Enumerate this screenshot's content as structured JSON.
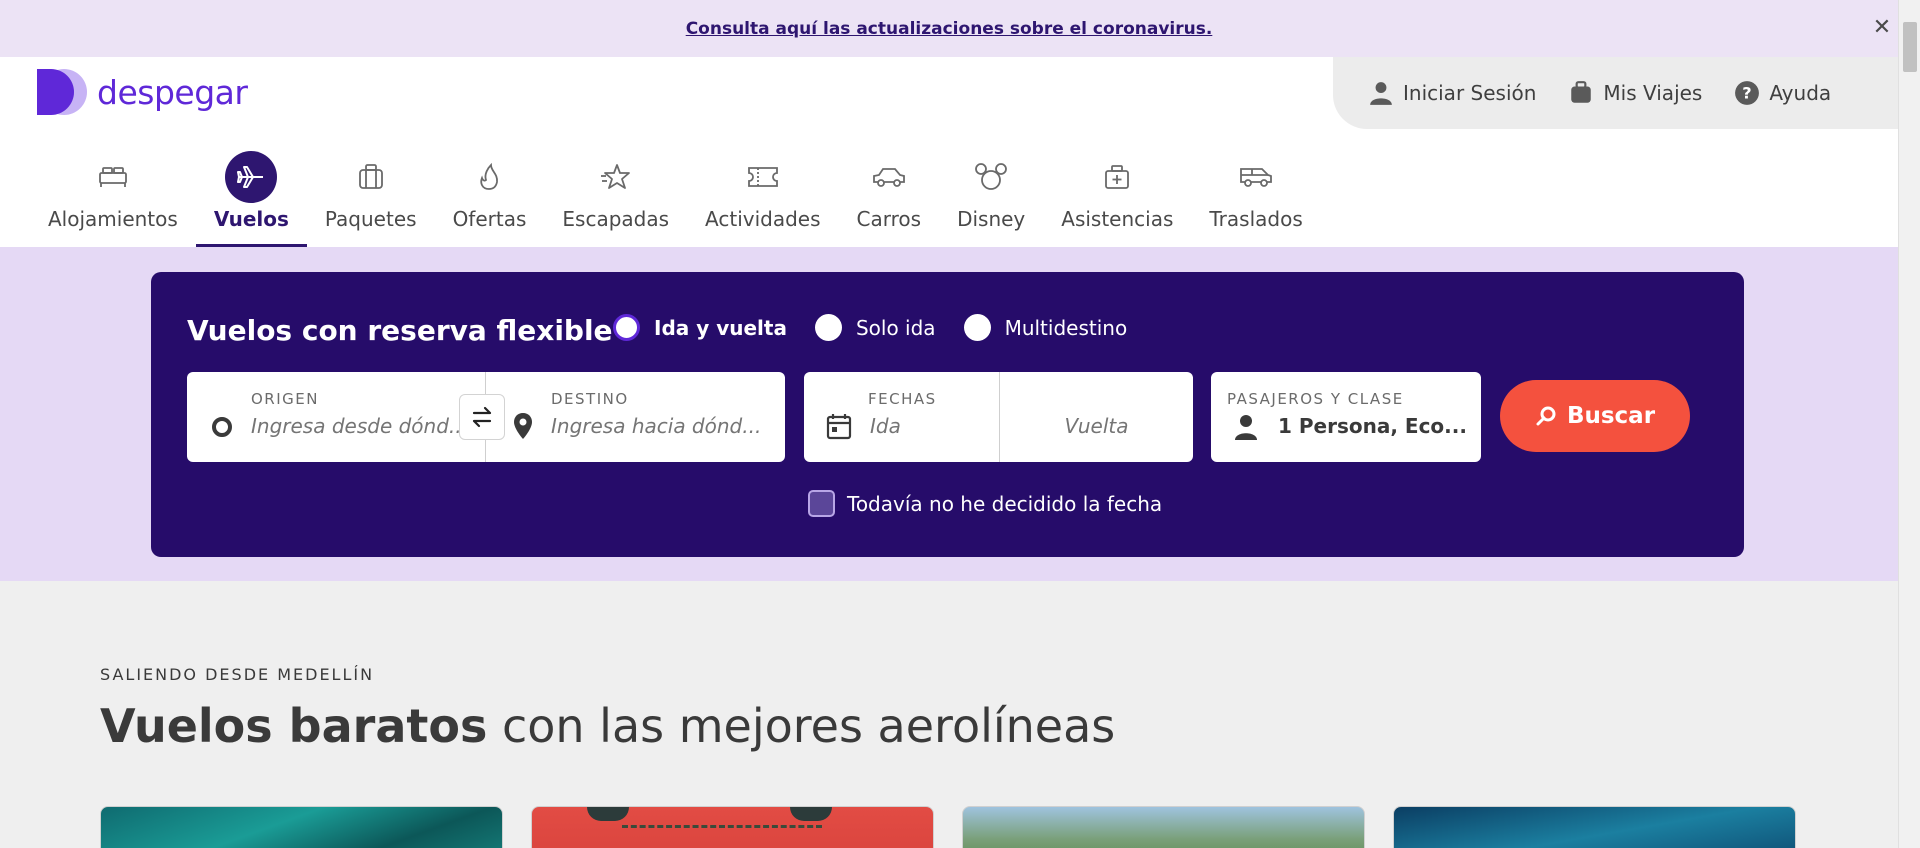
{
  "banner": {
    "link_text": "Consulta aquí las actualizaciones sobre el coronavirus.",
    "close_icon": "close-icon"
  },
  "brand": {
    "name": "despegar",
    "color": "#5f28d8",
    "primary_dark": "#260c6a",
    "accent": "#f4513e"
  },
  "user_menu": {
    "items": [
      {
        "label": "Iniciar Sesión",
        "icon": "user-icon"
      },
      {
        "label": "Mis Viajes",
        "icon": "suitcase-icon"
      },
      {
        "label": "Ayuda",
        "icon": "help-icon"
      }
    ]
  },
  "nav": {
    "items": [
      {
        "label": "Alojamientos",
        "icon": "bed-icon",
        "active": false
      },
      {
        "label": "Vuelos",
        "icon": "plane-icon",
        "active": true
      },
      {
        "label": "Paquetes",
        "icon": "luggage-icon",
        "active": false
      },
      {
        "label": "Ofertas",
        "icon": "flame-icon",
        "active": false
      },
      {
        "label": "Escapadas",
        "icon": "star-icon",
        "active": false
      },
      {
        "label": "Actividades",
        "icon": "ticket-icon",
        "active": false
      },
      {
        "label": "Carros",
        "icon": "car-icon",
        "active": false
      },
      {
        "label": "Disney",
        "icon": "mickey-icon",
        "active": false
      },
      {
        "label": "Asistencias",
        "icon": "medical-kit-icon",
        "active": false
      },
      {
        "label": "Traslados",
        "icon": "van-icon",
        "active": false
      }
    ]
  },
  "search": {
    "title": "Vuelos con reserva flexible",
    "trip_types": [
      {
        "label": "Ida y vuelta",
        "checked": true
      },
      {
        "label": "Solo ida",
        "checked": false
      },
      {
        "label": "Multidestino",
        "checked": false
      }
    ],
    "origin": {
      "label": "ORIGEN",
      "placeholder": "Ingresa desde dónd..."
    },
    "destination": {
      "label": "DESTINO",
      "placeholder": "Ingresa hacia dónd..."
    },
    "dates": {
      "label": "FECHAS",
      "departure_placeholder": "Ida",
      "return_placeholder": "Vuelta"
    },
    "passengers": {
      "label": "PASAJEROS Y CLASE",
      "value": "1 Persona, Eco..."
    },
    "button_label": "Buscar",
    "undecided_label": "Todavía no he decidido la fecha"
  },
  "section": {
    "eyebrow": "SALIENDO DESDE MEDELLÍN",
    "headline_bold": "Vuelos baratos",
    "headline_rest": " con las mejores aerolíneas"
  }
}
